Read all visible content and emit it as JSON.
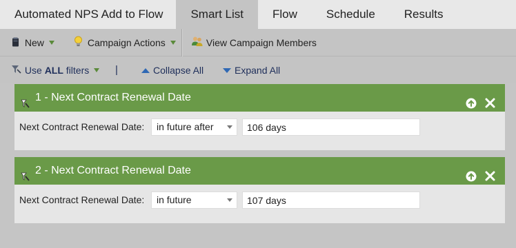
{
  "tabs": [
    {
      "label": "Automated NPS Add to Flow",
      "active": false
    },
    {
      "label": "Smart List",
      "active": true
    },
    {
      "label": "Flow",
      "active": false
    },
    {
      "label": "Schedule",
      "active": false
    },
    {
      "label": "Results",
      "active": false
    }
  ],
  "toolbar": {
    "new_label": "New",
    "campaign_actions_label": "Campaign Actions",
    "view_members_label": "View Campaign Members"
  },
  "filterbar": {
    "use_prefix": "Use ",
    "use_bold": "ALL",
    "use_suffix": " filters",
    "separator": "|",
    "collapse_label": "Collapse All",
    "expand_label": "Expand All"
  },
  "filters": [
    {
      "title": "1 - Next Contract Renewal Date",
      "field_label": "Next Contract Renewal Date:",
      "operator": "in future after",
      "value": "106 days"
    },
    {
      "title": "2 - Next Contract Renewal Date",
      "field_label": "Next Contract Renewal Date:",
      "operator": "in future",
      "value": "107 days"
    }
  ],
  "colors": {
    "card_header": "#6a9a48",
    "active_tab": "#c4c4c4",
    "link_blue": "#2f68b4"
  }
}
